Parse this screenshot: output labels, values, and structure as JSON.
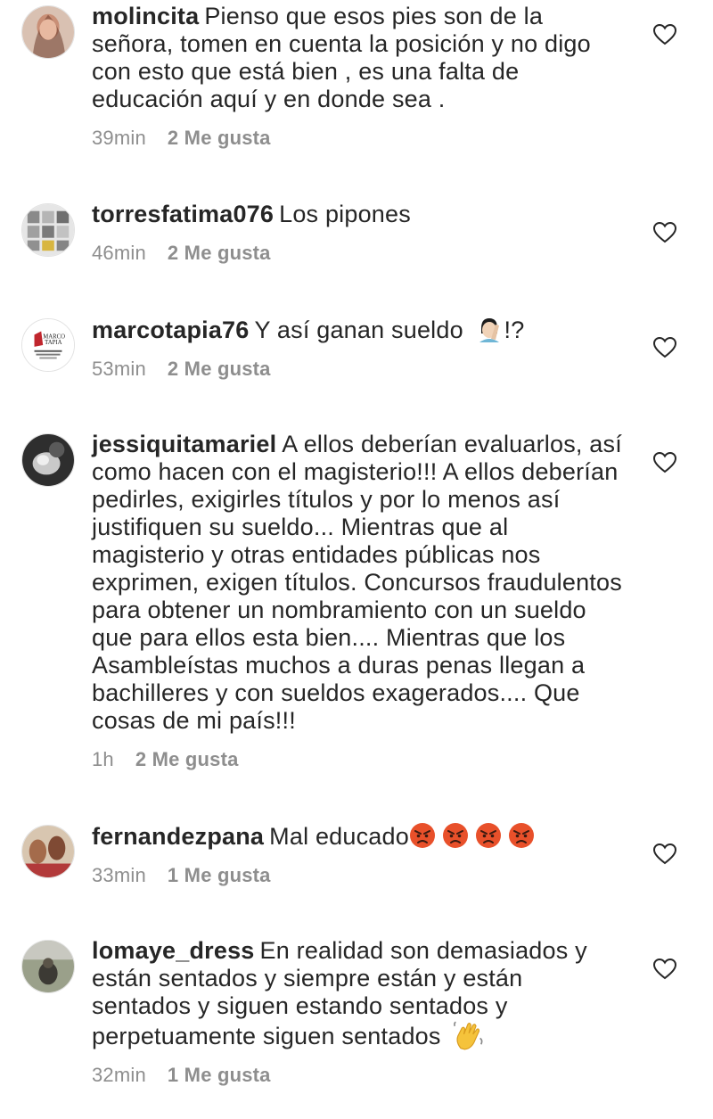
{
  "comments": [
    {
      "username": "molincita",
      "text": "Pienso que esos pies son de la señora, tomen en cuenta la posición y no digo con esto que está bien , es una falta de educación aquí y en donde sea .",
      "time": "39min",
      "likes": "2 Me gusta"
    },
    {
      "username": "torresfatima076",
      "text": "Los pipones",
      "time": "46min",
      "likes": "2 Me gusta"
    },
    {
      "username": "marcotapia76",
      "text": "Y así ganan sueldo",
      "text_suffix": "!?",
      "emoji": "facepalm-emoji",
      "avatar_logo_lines": [
        "MARCO",
        "TAPIA"
      ],
      "time": "53min",
      "likes": "2 Me gusta"
    },
    {
      "username": "jessiquitamariel",
      "text": "A ellos deberían evaluarlos, así como hacen con el magisterio!!! A ellos deberían pedirles, exigirles títulos y por lo menos así justifiquen su sueldo... Mientras que al magisterio y otras entidades públicas nos exprimen, exigen títulos. Concursos fraudulentos para obtener un nombramiento con un sueldo que para ellos esta bien.... Mientras que los Asambleístas muchos a duras penas llegan a bachilleres y con sueldos exagerados.... Que cosas de mi país!!!",
      "time": "1h",
      "likes": "2 Me gusta"
    },
    {
      "username": "fernandezpana",
      "text": "Mal educado",
      "emoji": "angry-face-emoji",
      "emoji_count": 4,
      "time": "33min",
      "likes": "1 Me gusta"
    },
    {
      "username": "lomaye_dress",
      "text": "En realidad son demasiados y están sentados y siempre están y están sentados y siguen estando sentados y perpetuamente siguen sentados",
      "emoji": "waving-hand-emoji",
      "time": "32min",
      "likes": "1 Me gusta"
    }
  ],
  "icons": {
    "like": "heart-outline-icon"
  },
  "colors": {
    "text": "#262626",
    "meta": "#8e8e8e",
    "angry": "#e8502a",
    "wave": "#f5c33b"
  }
}
